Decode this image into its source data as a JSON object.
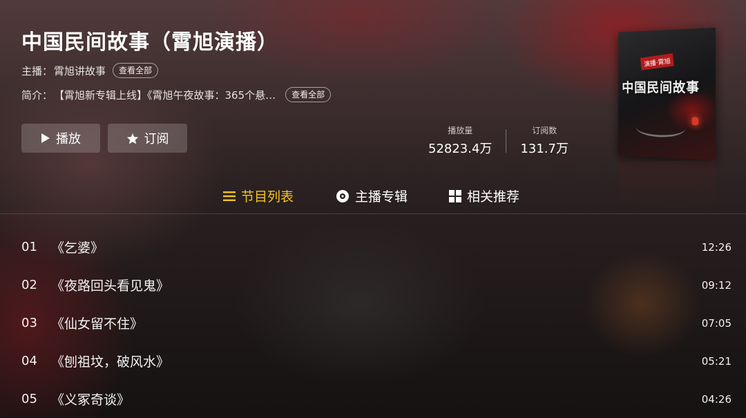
{
  "album": {
    "title": "中国民间故事（霄旭演播）",
    "host_label": "主播：",
    "host_name": "霄旭讲故事",
    "host_more": "查看全部",
    "intro_label": "简介：",
    "intro_text": "【霄旭新专辑上线】《霄旭午夜故事：365个悬…",
    "intro_more": "查看全部",
    "cover_title": "中国民间故事",
    "cover_stamp": "演播·霄旭"
  },
  "actions": {
    "play_label": "播放",
    "play_icon": "play-icon",
    "subscribe_label": "订阅",
    "subscribe_icon": "star-icon"
  },
  "stats": {
    "plays_label": "播放量",
    "plays_value": "52823.4万",
    "subs_label": "订阅数",
    "subs_value": "131.7万"
  },
  "tabs": [
    {
      "label": "节目列表",
      "icon": "list-icon",
      "active": true
    },
    {
      "label": "主播专辑",
      "icon": "disc-icon",
      "active": false
    },
    {
      "label": "相关推荐",
      "icon": "grid-icon",
      "active": false
    }
  ],
  "colors": {
    "accent": "#f5c518",
    "text": "#ffffff"
  },
  "episodes": [
    {
      "num": "01",
      "title": "《乞婆》",
      "duration": "12:26"
    },
    {
      "num": "02",
      "title": "《夜路回头看见鬼》",
      "duration": "09:12"
    },
    {
      "num": "03",
      "title": "《仙女留不住》",
      "duration": "07:05"
    },
    {
      "num": "04",
      "title": "《刨祖坟，破风水》",
      "duration": "05:21"
    },
    {
      "num": "05",
      "title": "《义冢奇谈》",
      "duration": "04:26"
    }
  ]
}
